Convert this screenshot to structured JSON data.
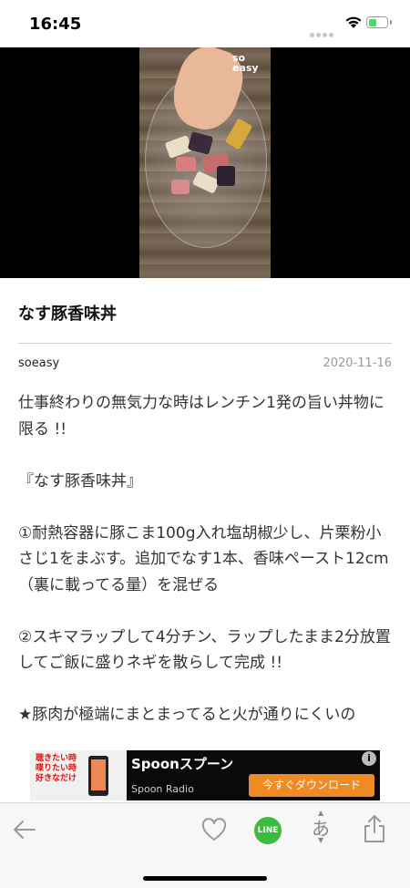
{
  "status_bar": {
    "time": "16:45"
  },
  "video": {
    "watermark": "so\neasy"
  },
  "article": {
    "title": "なす豚香味丼",
    "author": "soeasy",
    "date": "2020-11-16",
    "paragraphs": [
      "仕事終わりの無気力な時はレンチン1発の旨い丼物に限る !!",
      "『なす豚香味丼』",
      "①耐熱容器に豚こま100g入れ塩胡椒少し、片栗粉小さじ1をまぶす。追加でなす1本、香味ペースト12cm（裏に載ってる量）を混ぜる",
      "②スキマラップして4分チン、ラップしたまま2分放置してご飯に盛りネギを散らして完成 !!",
      "★豚肉が極端にまとまってると火が通りにくいの"
    ]
  },
  "ad": {
    "image_text": "聴きたい時\n喋りたい時\n好きなだけ",
    "title": "Spoonスプーン",
    "subtitle": "Spoon Radio",
    "button": "今すぐダウンロード",
    "info": "i"
  },
  "toolbar": {
    "line_label": "LINE",
    "font_glyph": "あ"
  }
}
